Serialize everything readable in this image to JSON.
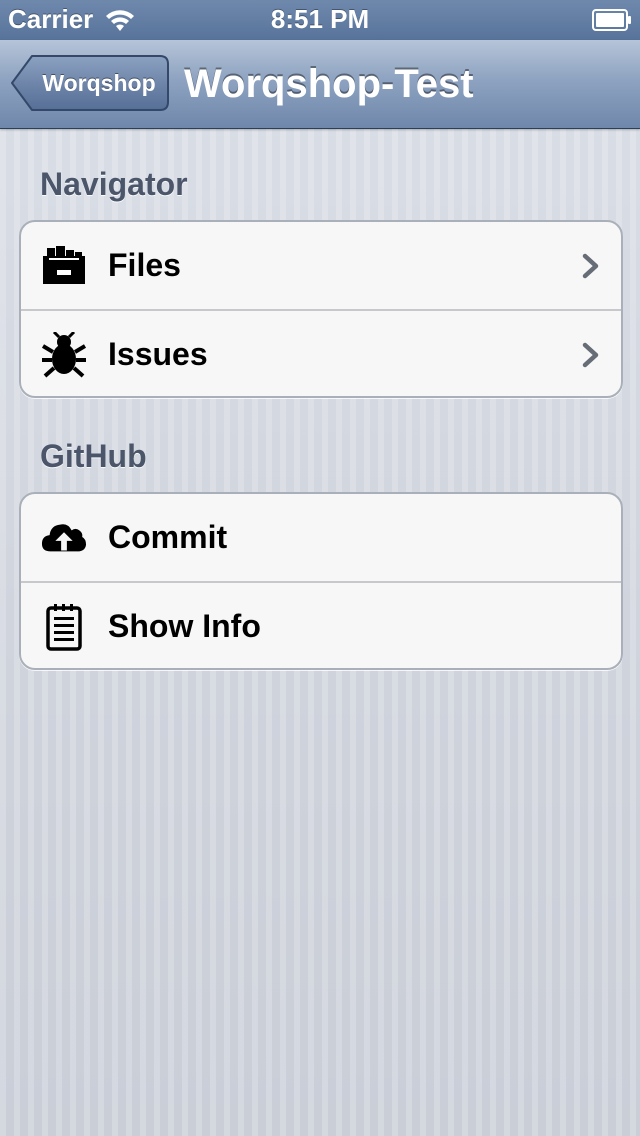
{
  "status_bar": {
    "carrier": "Carrier",
    "time": "8:51 PM",
    "icons": [
      "wifi-icon",
      "battery-icon"
    ]
  },
  "nav_bar": {
    "back_label": "Worqshop",
    "title": "Worqshop-Test"
  },
  "sections": [
    {
      "header": "Navigator",
      "rows": [
        {
          "label": "Files",
          "icon": "file-cabinet-icon",
          "disclosure": true
        },
        {
          "label": "Issues",
          "icon": "bug-icon",
          "disclosure": true
        }
      ]
    },
    {
      "header": "GitHub",
      "rows": [
        {
          "label": "Commit",
          "icon": "cloud-upload-icon",
          "disclosure": false
        },
        {
          "label": "Show Info",
          "icon": "notepad-icon",
          "disclosure": false
        }
      ]
    }
  ],
  "colors": {
    "nav_bar": "#7e95b7",
    "section_header": "#4c566b",
    "background": "#cbd0d9",
    "cell": "#f7f7f7"
  }
}
